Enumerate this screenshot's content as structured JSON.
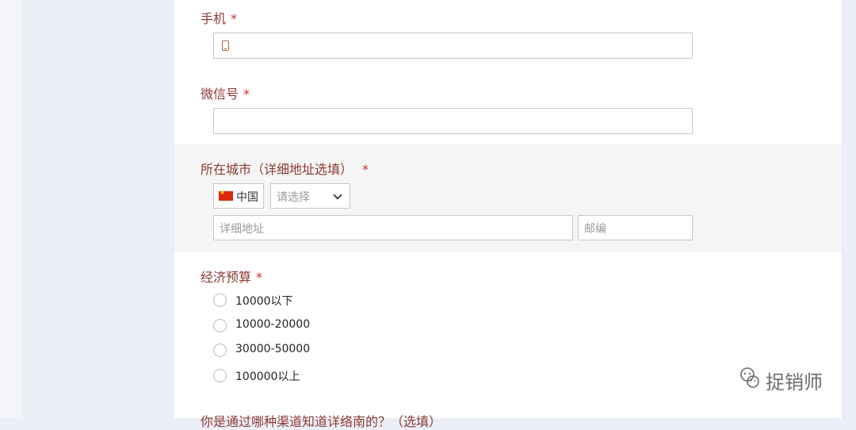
{
  "form": {
    "phone": {
      "label": "手机",
      "required_mark": "*",
      "value": ""
    },
    "wechat": {
      "label": "微信号",
      "required_mark": "*",
      "value": ""
    },
    "city": {
      "label": "所在城市（详细地址选填）",
      "required_mark": "*",
      "country": "中国",
      "region_select_placeholder": "请选择",
      "address_placeholder": "详细地址",
      "postcode_placeholder": "邮编"
    },
    "budget": {
      "label": "经济预算",
      "required_mark": "*",
      "options": [
        "10000以下",
        "10000-20000",
        "30000-50000",
        "100000以上"
      ]
    },
    "next_question_partial": "你是通过哪种渠道知道详络南的？（选填）"
  },
  "watermark": {
    "text": "捉销师",
    "icon": "wechat-icon"
  },
  "colors": {
    "label": "#8d3a31",
    "required": "#c9302c",
    "background": "#eceff8",
    "section_highlight": "#f5f5f5"
  }
}
